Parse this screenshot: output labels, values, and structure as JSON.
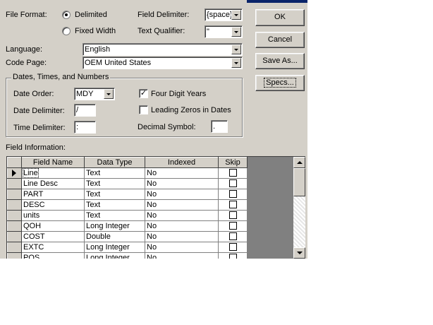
{
  "file_format": {
    "label": "File Format:",
    "options": [
      {
        "label": "Delimited",
        "selected": true
      },
      {
        "label": "Fixed Width",
        "selected": false
      }
    ]
  },
  "field_delimiter": {
    "label": "Field Delimiter:",
    "value": "{space}"
  },
  "text_qualifier": {
    "label": "Text Qualifier:",
    "value": "\""
  },
  "language": {
    "label": "Language:",
    "value": "English"
  },
  "code_page": {
    "label": "Code Page:",
    "value": "OEM United States"
  },
  "buttons": {
    "ok": "OK",
    "cancel": "Cancel",
    "save_as": "Save As...",
    "specs": "Specs..."
  },
  "dates_group": {
    "title": "Dates, Times, and Numbers",
    "date_order": {
      "label": "Date Order:",
      "value": "MDY"
    },
    "date_delimiter": {
      "label": "Date Delimiter:",
      "value": "/"
    },
    "time_delimiter": {
      "label": "Time Delimiter:",
      "value": ":"
    },
    "four_digit_years": {
      "label": "Four Digit Years",
      "checked": true
    },
    "leading_zeros": {
      "label": "Leading Zeros in Dates",
      "checked": false
    },
    "decimal_symbol": {
      "label": "Decimal Symbol:",
      "value": "."
    }
  },
  "field_info": {
    "label": "Field Information:",
    "columns": [
      "Field Name",
      "Data Type",
      "Indexed",
      "Skip"
    ],
    "rows": [
      {
        "name": "Line",
        "type": "Text",
        "indexed": "No",
        "skip": false
      },
      {
        "name": "Line Desc",
        "type": "Text",
        "indexed": "No",
        "skip": false
      },
      {
        "name": "PART",
        "type": "Text",
        "indexed": "No",
        "skip": false
      },
      {
        "name": "DESC",
        "type": "Text",
        "indexed": "No",
        "skip": false
      },
      {
        "name": "units",
        "type": "Text",
        "indexed": "No",
        "skip": false
      },
      {
        "name": "QOH",
        "type": "Long Integer",
        "indexed": "No",
        "skip": false
      },
      {
        "name": "COST",
        "type": "Double",
        "indexed": "No",
        "skip": false
      },
      {
        "name": "EXTC",
        "type": "Long Integer",
        "indexed": "No",
        "skip": false
      },
      {
        "name": "POS",
        "type": "Long Integer",
        "indexed": "No",
        "skip": false
      }
    ]
  },
  "icons": [
    "current-row-arrow-icon",
    "dropdown-arrow-icon",
    "scroll-up-icon",
    "scroll-down-icon"
  ]
}
